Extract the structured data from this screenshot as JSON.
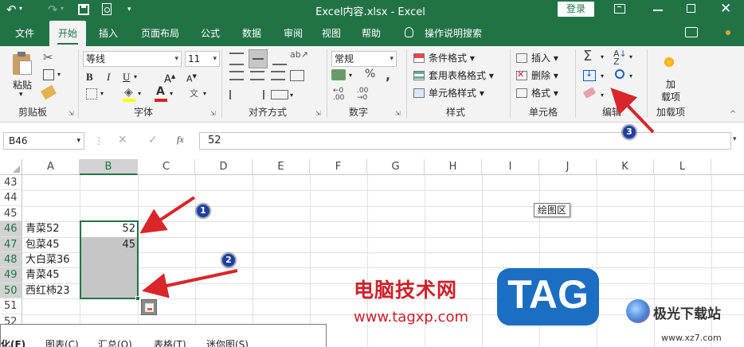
{
  "titlebar": {
    "title": "Excel内容.xlsx  -  Excel",
    "login_label": "登录"
  },
  "tabs": [
    {
      "label": "文件"
    },
    {
      "label": "开始"
    },
    {
      "label": "插入"
    },
    {
      "label": "页面布局"
    },
    {
      "label": "公式"
    },
    {
      "label": "数据"
    },
    {
      "label": "审阅"
    },
    {
      "label": "视图"
    },
    {
      "label": "帮助"
    },
    {
      "label": "操作说明搜索"
    }
  ],
  "ribbon": {
    "clipboard": {
      "paste_label": "粘贴",
      "group_label": "剪贴板"
    },
    "font": {
      "font_name": "等线",
      "font_size": "11",
      "group_label": "字体"
    },
    "align": {
      "group_label": "对齐方式"
    },
    "number": {
      "format": "常规",
      "group_label": "数字"
    },
    "styles": {
      "cond_format": "条件格式",
      "table_format": "套用表格格式",
      "cell_style": "单元格样式",
      "group_label": "样式"
    },
    "cells": {
      "insert": "插入",
      "delete": "删除",
      "format": "格式",
      "group_label": "单元格"
    },
    "edit": {
      "group_label": "编辑"
    },
    "addins": {
      "label_line1": "加",
      "label_line2": "载项",
      "group_label": "加载项"
    }
  },
  "formula_bar": {
    "name_box": "B46",
    "fx": "fx",
    "content": "52"
  },
  "columns": [
    "A",
    "B",
    "C",
    "D",
    "E",
    "F",
    "G",
    "H",
    "I",
    "J",
    "K",
    "L"
  ],
  "rows": [
    "43",
    "44",
    "45",
    "46",
    "47",
    "48",
    "49",
    "50",
    "51",
    "52"
  ],
  "cells": {
    "A46": "青菜52",
    "B46": "52",
    "A47": "包菜45",
    "B47": "45",
    "A48": "大白菜36",
    "A49": "青菜45",
    "A50": "西红柿23"
  },
  "plot_area_tooltip": "绘图区",
  "quick_analysis": {
    "tabs": [
      "化(F)",
      "图表(C)",
      "汇总(O)",
      "表格(T)",
      "迷你图(S)"
    ]
  },
  "annotations": [
    "1",
    "2",
    "3"
  ],
  "watermark": {
    "text1": "电脑技术网",
    "url": "www.tagxp.com",
    "logo": "TAG",
    "site": "极光下载站",
    "site_url": "www.xz7.com"
  },
  "colors": {
    "excel_green": "#217346",
    "watermark_red": "#d0202a",
    "watermark_blue": "#1b6ec2",
    "arrow_red": "#d9262a"
  }
}
